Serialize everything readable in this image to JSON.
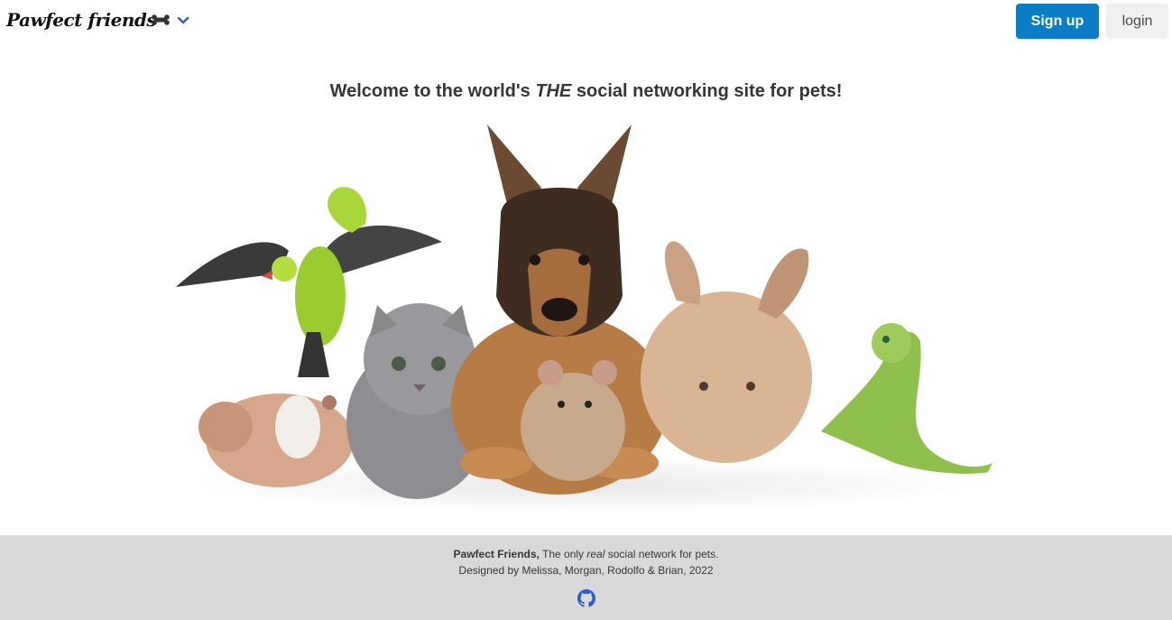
{
  "nav": {
    "logo_text": "Pawfect friends",
    "menu_icon": "bone-icon",
    "chevron_icon": "chevron-down-icon",
    "signup_label": "Sign up",
    "login_label": "login",
    "accent_color": "#0a7dc6"
  },
  "hero": {
    "headline_before": "Welcome to the world's ",
    "headline_emph": "THE",
    "headline_after": " social networking site for pets!",
    "image_subject": "group-of-pets-image"
  },
  "footer": {
    "brand": "Pawfect Friends,",
    "tagline_before": " The only ",
    "tagline_emph": "real",
    "tagline_after": " social network for pets.",
    "credits": "Designed by Melissa, Morgan, Rodolfo & Brian, 2022",
    "github_icon": "github-icon",
    "background": "#d9d9d9"
  }
}
